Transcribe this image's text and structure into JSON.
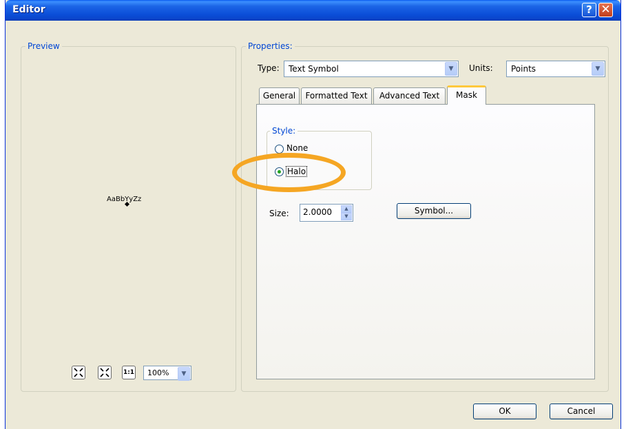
{
  "window": {
    "title": "Editor"
  },
  "titlebar": {
    "help_glyph": "?",
    "close_glyph": "✕"
  },
  "preview": {
    "label": "Preview",
    "sample_text": "AaBbYyZz",
    "zoom_buttons": [
      "zoom-in-icon",
      "zoom-out-icon",
      "actual-size-icon"
    ],
    "zoom_value": "100%"
  },
  "properties": {
    "label": "Properties:",
    "type_label": "Type:",
    "type_value": "Text Symbol",
    "units_label": "Units:",
    "units_value": "Points"
  },
  "tabs": [
    {
      "label": "General",
      "active": false
    },
    {
      "label": "Formatted Text",
      "active": false
    },
    {
      "label": "Advanced Text",
      "active": false
    },
    {
      "label": "Mask",
      "active": true
    }
  ],
  "mask": {
    "style_label": "Style:",
    "options": [
      {
        "label": "None",
        "checked": false
      },
      {
        "label": "Halo",
        "checked": true
      }
    ],
    "size_label": "Size:",
    "size_value": "2.0000",
    "symbol_button": "Symbol..."
  },
  "footer": {
    "ok_label": "OK",
    "cancel_label": "Cancel"
  },
  "colors": {
    "title_bar": "#0a46cc",
    "group_label": "#0046d5",
    "highlight": "#f5a623",
    "dialog_bg": "#ece9d8"
  }
}
